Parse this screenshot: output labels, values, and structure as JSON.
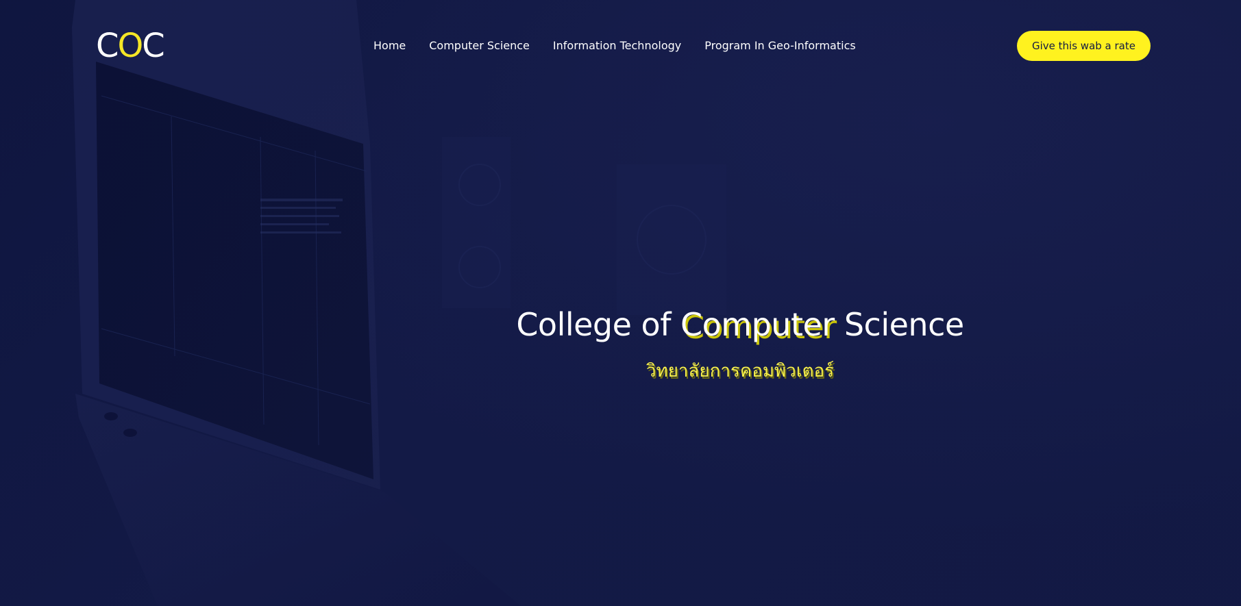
{
  "logo": {
    "letter1": "C",
    "letter2": "O",
    "letter3": "C"
  },
  "nav": {
    "items": [
      {
        "label": "Home"
      },
      {
        "label": "Computer Science"
      },
      {
        "label": "Information Technology"
      },
      {
        "label": "Program In Geo-Informatics"
      }
    ]
  },
  "cta": {
    "label": "Give this wab a rate"
  },
  "hero": {
    "title_part1": "College of ",
    "title_highlight": "Computer",
    "title_part2": " Science",
    "subtitle": "วิทยาลัยการคอมพิวเตอร์"
  },
  "colors": {
    "background": "#121a44",
    "accent": "#fff21f",
    "text": "#ffffff"
  }
}
